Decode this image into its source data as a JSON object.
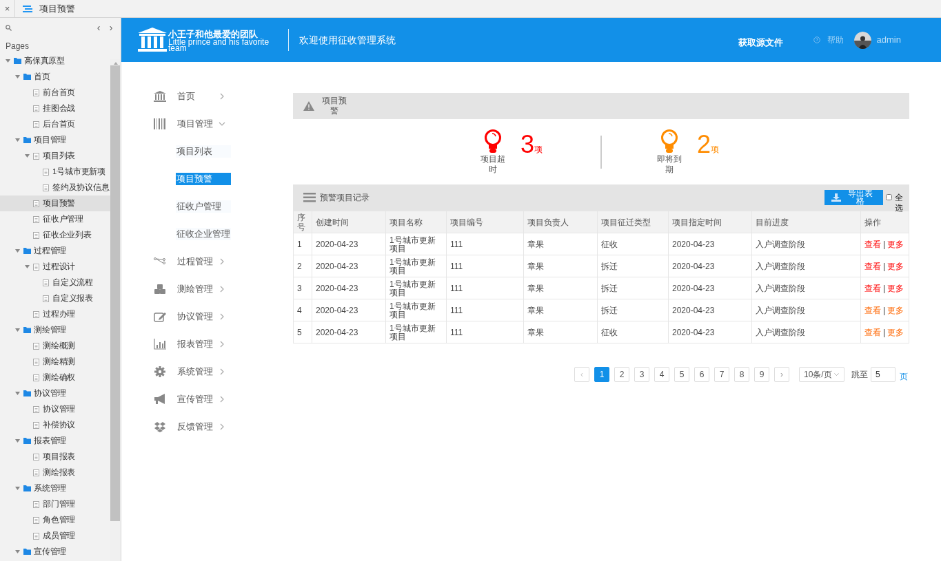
{
  "top_bar": {
    "close": "×",
    "title": "项目预警"
  },
  "pages_panel": {
    "nav_prev": "‹",
    "nav_next": "›",
    "heading": "Pages",
    "tree": [
      {
        "label": "高保真原型",
        "kind": "folder",
        "expanded": true,
        "selected": false,
        "children": [
          {
            "label": "首页",
            "kind": "folder",
            "expanded": true,
            "selected": false,
            "children": [
              {
                "label": "前台首页",
                "kind": "page",
                "selected": false
              },
              {
                "label": "挂图会战",
                "kind": "page",
                "selected": false
              },
              {
                "label": "后台首页",
                "kind": "page",
                "selected": false
              }
            ]
          },
          {
            "label": "项目管理",
            "kind": "folder",
            "expanded": true,
            "selected": false,
            "children": [
              {
                "label": "项目列表",
                "kind": "page",
                "expanded": true,
                "selected": false,
                "children": [
                  {
                    "label": "1号城市更新项",
                    "kind": "page",
                    "selected": false
                  },
                  {
                    "label": "签约及协议信息",
                    "kind": "page",
                    "selected": false
                  }
                ]
              },
              {
                "label": "项目预警",
                "kind": "page",
                "selected": true
              },
              {
                "label": "征收户管理",
                "kind": "page",
                "selected": false
              },
              {
                "label": "征收企业列表",
                "kind": "page",
                "selected": false
              }
            ]
          },
          {
            "label": "过程管理",
            "kind": "folder",
            "expanded": true,
            "selected": false,
            "children": [
              {
                "label": "过程设计",
                "kind": "page",
                "expanded": true,
                "selected": false,
                "children": [
                  {
                    "label": "自定义流程",
                    "kind": "page",
                    "selected": false
                  },
                  {
                    "label": "自定义报表",
                    "kind": "page",
                    "selected": false
                  }
                ]
              },
              {
                "label": "过程办理",
                "kind": "page",
                "selected": false
              }
            ]
          },
          {
            "label": "测绘管理",
            "kind": "folder",
            "expanded": true,
            "selected": false,
            "children": [
              {
                "label": "测绘概测",
                "kind": "page",
                "selected": false
              },
              {
                "label": "测绘精测",
                "kind": "page",
                "selected": false
              },
              {
                "label": "测绘确权",
                "kind": "page",
                "selected": false
              }
            ]
          },
          {
            "label": "协议管理",
            "kind": "folder",
            "expanded": true,
            "selected": false,
            "children": [
              {
                "label": "协议管理",
                "kind": "page",
                "selected": false
              },
              {
                "label": "补偿协议",
                "kind": "page",
                "selected": false
              }
            ]
          },
          {
            "label": "报表管理",
            "kind": "folder",
            "expanded": true,
            "selected": false,
            "children": [
              {
                "label": "项目报表",
                "kind": "page",
                "selected": false
              },
              {
                "label": "测绘报表",
                "kind": "page",
                "selected": false
              }
            ]
          },
          {
            "label": "系统管理",
            "kind": "folder",
            "expanded": true,
            "selected": false,
            "children": [
              {
                "label": "部门管理",
                "kind": "page",
                "selected": false
              },
              {
                "label": "角色管理",
                "kind": "page",
                "selected": false
              },
              {
                "label": "成员管理",
                "kind": "page",
                "selected": false
              }
            ]
          },
          {
            "label": "宣传管理",
            "kind": "folder",
            "expanded": true,
            "selected": false
          }
        ]
      }
    ]
  },
  "header": {
    "team_name": "小王子和他最爱的团队",
    "team_subtitle": "Little prince and his favorite team",
    "welcome": "欢迎使用征收管理系统",
    "source_link": "获取源文件",
    "help": "帮助",
    "user": "admin"
  },
  "nav_menu": [
    {
      "label": "首页",
      "expanded": false
    },
    {
      "label": "项目管理",
      "expanded": true,
      "children": [
        {
          "label": "项目列表",
          "selected": false
        },
        {
          "label": "项目预警",
          "selected": true
        },
        {
          "label": "征收户管理",
          "selected": false
        },
        {
          "label": "征收企业管理",
          "selected": false
        }
      ]
    },
    {
      "label": "过程管理",
      "expanded": false
    },
    {
      "label": "测绘管理",
      "expanded": false
    },
    {
      "label": "协议管理",
      "expanded": false
    },
    {
      "label": "报表管理",
      "expanded": false
    },
    {
      "label": "系统管理",
      "expanded": false
    },
    {
      "label": "宣传管理",
      "expanded": false
    },
    {
      "label": "反馈管理",
      "expanded": false
    }
  ],
  "alert_panel": {
    "title": "项目预警",
    "stats": [
      {
        "label": "项目超时",
        "count": "3",
        "unit": "项",
        "color": "#ff0000"
      },
      {
        "label": "即将到期",
        "count": "2",
        "unit": "项",
        "color": "#ff8c00"
      }
    ]
  },
  "records": {
    "title": "预警项目记录",
    "export_button": "导出表格",
    "select_all": {
      "label": "全选",
      "checked": false
    },
    "columns": [
      "序号",
      "创建时间",
      "项目名称",
      "项目编号",
      "项目负责人",
      "项目征迁类型",
      "项目指定时间",
      "目前进度",
      "操作"
    ],
    "rows": [
      {
        "cells": [
          "1",
          "2020-04-23",
          "1号城市更新项目",
          "111",
          "章果",
          "征收",
          "2020-04-23",
          "入户调查阶段"
        ],
        "actions": [
          "查看",
          "更多"
        ],
        "separator": "|",
        "kind": "overdue"
      },
      {
        "cells": [
          "2",
          "2020-04-23",
          "1号城市更新项目",
          "111",
          "章果",
          "拆迁",
          "2020-04-23",
          "入户调查阶段"
        ],
        "actions": [
          "查看",
          "更多"
        ],
        "separator": "|",
        "kind": "overdue"
      },
      {
        "cells": [
          "3",
          "2020-04-23",
          "1号城市更新项目",
          "111",
          "章果",
          "拆迁",
          "2020-04-23",
          "入户调查阶段"
        ],
        "actions": [
          "查看",
          "更多"
        ],
        "separator": "|",
        "kind": "overdue"
      },
      {
        "cells": [
          "4",
          "2020-04-23",
          "1号城市更新项目",
          "111",
          "章果",
          "拆迁",
          "2020-04-23",
          "入户调查阶段"
        ],
        "actions": [
          "查看",
          "更多"
        ],
        "separator": "|",
        "kind": "expiring"
      },
      {
        "cells": [
          "5",
          "2020-04-23",
          "1号城市更新项目",
          "111",
          "章果",
          "征收",
          "2020-04-23",
          "入户调查阶段"
        ],
        "actions": [
          "查看",
          "更多"
        ],
        "separator": "|",
        "kind": "expiring"
      }
    ]
  },
  "pagination": {
    "prev": "‹",
    "next": "›",
    "pages": [
      {
        "label": "1",
        "selected": true
      },
      {
        "label": "2",
        "selected": false
      },
      {
        "label": "3",
        "selected": false
      },
      {
        "label": "4",
        "selected": false
      },
      {
        "label": "5",
        "selected": false
      },
      {
        "label": "6",
        "selected": false
      },
      {
        "label": "7",
        "selected": false
      },
      {
        "label": "8",
        "selected": false
      },
      {
        "label": "9",
        "selected": false
      }
    ],
    "page_size": "10条/页",
    "jump_label": "跳至",
    "jump_value": "5",
    "jump_unit": "页"
  }
}
